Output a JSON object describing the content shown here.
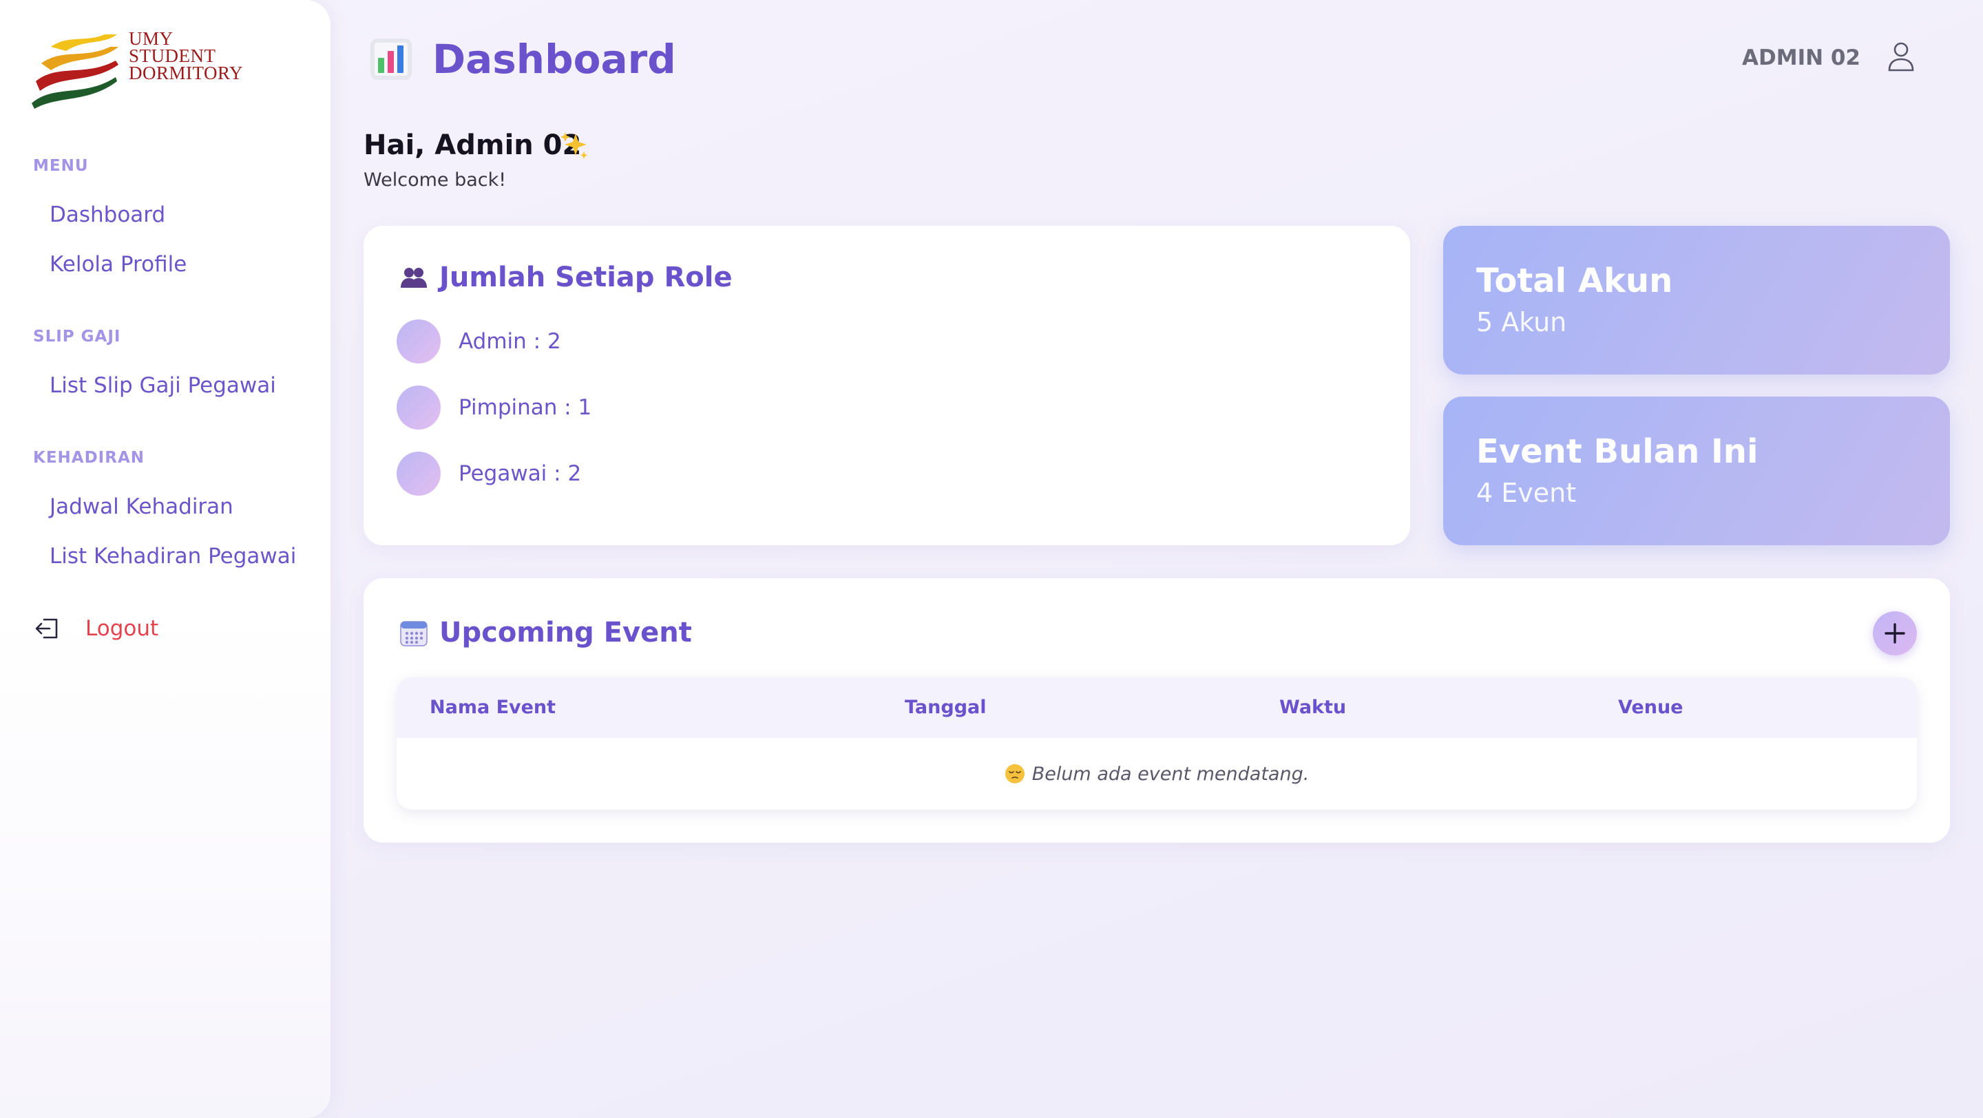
{
  "brand": {
    "logo_lines": [
      "UMY",
      "STUDENT",
      "DORMITORY"
    ]
  },
  "sidebar": {
    "sections": [
      {
        "title": "MENU",
        "items": [
          {
            "label": "Dashboard"
          },
          {
            "label": "Kelola Profile"
          }
        ]
      },
      {
        "title": "SLIP GAJI",
        "items": [
          {
            "label": "List Slip Gaji Pegawai"
          }
        ]
      },
      {
        "title": "KEHADIRAN",
        "items": [
          {
            "label": "Jadwal Kehadiran"
          },
          {
            "label": "List Kehadiran Pegawai"
          }
        ]
      }
    ],
    "logout_label": "Logout"
  },
  "header": {
    "title": "Dashboard",
    "title_icon": "bar-chart-icon",
    "user_name": "ADMIN 02",
    "user_icon": "user-icon"
  },
  "greeting": {
    "title": "Hai, Admin 02",
    "subtitle": "Welcome back!",
    "icon": "sparkles-icon"
  },
  "roles_card": {
    "title": "Jumlah Setiap Role",
    "icon": "users-icon",
    "items": [
      {
        "label": "Admin : 2"
      },
      {
        "label": "Pimpinan : 1"
      },
      {
        "label": "Pegawai : 2"
      }
    ]
  },
  "stats": [
    {
      "title": "Total Akun",
      "value": "5 Akun"
    },
    {
      "title": "Event Bulan Ini",
      "value": "4 Event"
    }
  ],
  "events": {
    "title": "Upcoming Event",
    "icon": "calendar-icon",
    "add_icon": "plus-icon",
    "columns": [
      "Nama Event",
      "Tanggal",
      "Waktu",
      "Venue"
    ],
    "empty_message": "Belum ada event mendatang.",
    "empty_icon": "sleepy-face-icon"
  },
  "colors": {
    "accent": "#6a52cc",
    "nav_text": "#6b55c8",
    "section_title": "#a394e6",
    "logout": "#e4424d",
    "stat_card": "#a6b4f6",
    "background": "#f3f0fb"
  }
}
